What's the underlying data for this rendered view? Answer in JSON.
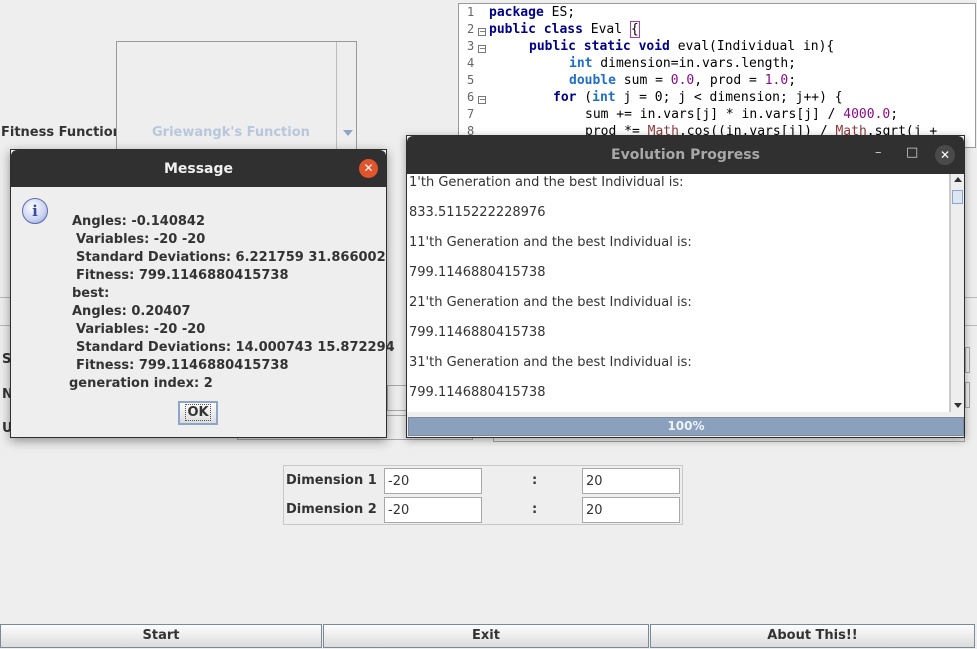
{
  "code_editor": {
    "line_numbers": [
      "1",
      "2",
      "3",
      "4",
      "5",
      "6",
      "7",
      "8"
    ],
    "lines": {
      "l1_kw": "package",
      "l1_rest": " ES;",
      "l2_kw1": "public",
      "l2_kw2": " class",
      "l2_rest": " Eval ",
      "l2_brace": "{",
      "l3_kw": "public static void",
      "l3_rest": " eval(Individual in){",
      "l4_ty": "int",
      "l4_rest": " dimension=in.vars.length;",
      "l5_ty": "double",
      "l5_rest1": " sum = ",
      "l5_n1": "0.0",
      "l5_rest2": ", prod = ",
      "l5_n2": "1.0",
      "l5_rest3": ";",
      "l6_kw": "for",
      "l6_rest1": " (",
      "l6_ty": "int",
      "l6_rest2": " j = 0; j < dimension; j++) {",
      "l7_rest1": "sum += in.vars[j] * in.vars[j] / ",
      "l7_n": "4000.0",
      "l7_rest2": ";",
      "l8_rest1": "prod *= ",
      "l8_m1": "Math",
      "l8_rest2": ".cos((in.vars[j]) / ",
      "l8_m2": "Math",
      "l8_rest3": ".sqrt(j +"
    }
  },
  "main": {
    "fitness_label": "Fitness Function",
    "fitness_value": "Griewangk's Function",
    "edge_letters": [
      "S",
      "N",
      "U"
    ],
    "dimensions": [
      {
        "label": "Dimension 1",
        "min": "-20",
        "sep": ":",
        "max": "20"
      },
      {
        "label": "Dimension 2",
        "min": "-20",
        "sep": ":",
        "max": "20"
      }
    ],
    "buttons": {
      "start": "Start",
      "exit": "Exit",
      "about": "About This!!"
    }
  },
  "evolution_window": {
    "title": "Evolution Progress",
    "controls": {
      "minimize": "–",
      "maximize": "□",
      "close": "✕"
    },
    "log": [
      "1'th Generation and the best Individual is:",
      "833.5115222228976",
      "11'th Generation and the best Individual is:",
      "799.1146880415738",
      "21'th Generation and the best Individual is:",
      "799.1146880415738",
      "31'th Generation and the best Individual is:",
      "799.1146880415738"
    ],
    "progress_text": "100%",
    "progress_fraction": 1.0
  },
  "message_dialog": {
    "title": "Message",
    "close": "✕",
    "icon": "info-icon",
    "lines": [
      "Angles: -0.140842",
      "Variables: -20 -20",
      "Standard Deviations: 6.221759 31.866002",
      "Fitness: 799.1146880415738",
      "best:",
      "Angles: 0.20407",
      "Variables: -20 -20",
      "Standard Deviations: 14.000743 15.872294",
      "Fitness: 799.1146880415738",
      "generation index: 2"
    ],
    "ok_label": "OK"
  },
  "colors": {
    "titlebar": "#303030",
    "dialog_close": "#e0552c",
    "progress_fill": "#8aa0bd",
    "keyword": "#00008b",
    "type": "#1e6fc9",
    "number": "#8b0a8b"
  }
}
